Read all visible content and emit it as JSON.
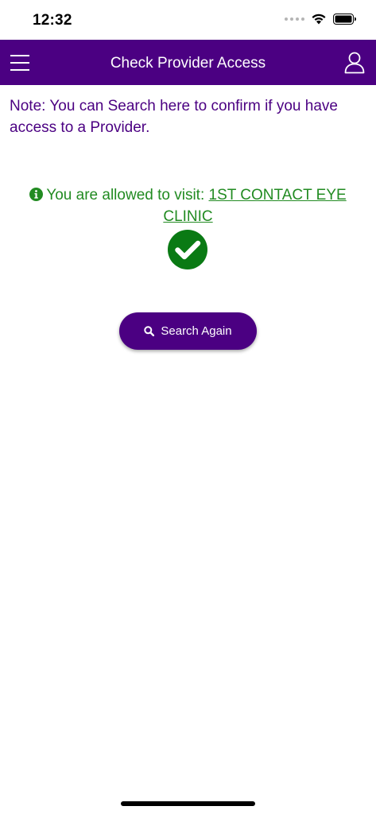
{
  "status_bar": {
    "time": "12:32",
    "icons": [
      "cellular-signal-icon",
      "wifi-icon",
      "battery-icon"
    ]
  },
  "header": {
    "title": "Check Provider Access",
    "left_icon": "hamburger-menu-icon",
    "right_icon": "user-profile-icon"
  },
  "main": {
    "note": "Note: You can Search here to confirm if you have access to a Provider.",
    "result_prefix": "You are allowed to visit:",
    "provider_name": "1ST CONTACT EYE CLINIC",
    "result_icon": "info-circle-icon",
    "status_icon": "check-circle-icon",
    "search_again_label": "Search Again",
    "search_icon": "search-icon"
  },
  "colors": {
    "brand_purple": "#4b0082",
    "success_green": "#228b22",
    "check_green": "#0a7a14",
    "white": "#ffffff"
  }
}
